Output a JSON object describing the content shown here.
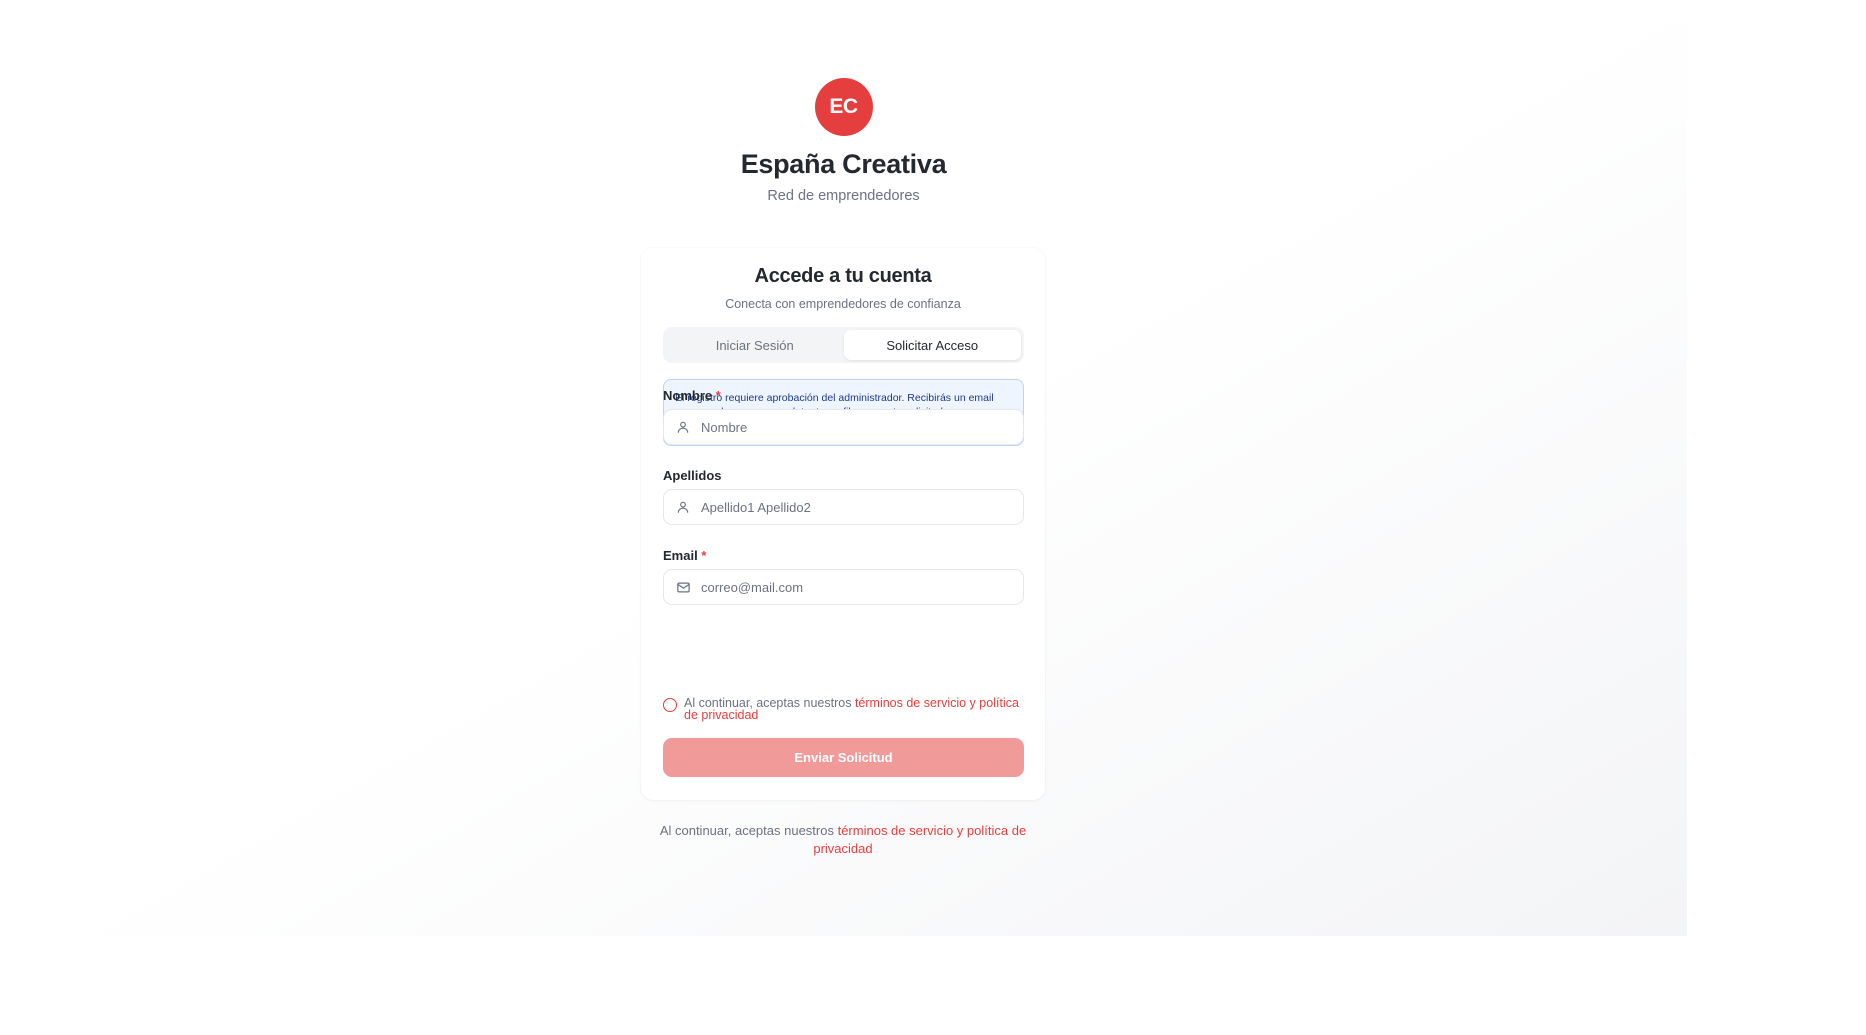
{
  "brand": {
    "logo_text": "EC",
    "title": "España Creativa",
    "subtitle": "Red de emprendedores",
    "accent": "#e53e3e"
  },
  "card": {
    "title": "Accede a tu cuenta",
    "subtitle": "Conecta con emprendedores de confianza",
    "tabs": [
      {
        "label": "Iniciar Sesión",
        "active": false
      },
      {
        "label": "Solicitar Acceso",
        "active": true
      }
    ],
    "notice": "El registro requiere aprobación del administrador. Recibirás un email con un enlace para completar tu perfil una vez tu solicitud sea aprobada.",
    "fields": {
      "nombre": {
        "label": "Nombre",
        "required_mark": "*",
        "placeholder": "Nombre",
        "icon": "user-icon"
      },
      "apellidos": {
        "label": "Apellidos",
        "placeholder": "Apellido1 Apellido2",
        "icon": "user-icon"
      },
      "email": {
        "label": "Email",
        "required_mark": "*",
        "placeholder": "correo@mail.com",
        "icon": "mail-icon"
      }
    },
    "terms": {
      "prefix": "Al continuar, aceptas nuestros ",
      "link": "términos de servicio y política de privacidad"
    },
    "submit_label": "Enviar Solicitud"
  },
  "footer": {
    "prefix": "Al continuar, aceptas nuestros ",
    "link": "términos de servicio y política de privacidad"
  }
}
